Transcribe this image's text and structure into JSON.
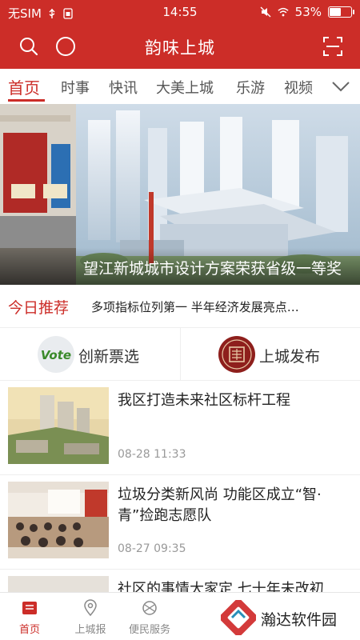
{
  "status_bar": {
    "carrier": "无SIM",
    "time": "14:55",
    "battery_text": "53%",
    "battery_level": 0.53
  },
  "header": {
    "title": "韵味上城",
    "background_color": "#cc2d28",
    "icons": [
      "search-icon",
      "circle-icon",
      "scan-icon"
    ]
  },
  "tabs": [
    {
      "label": "首页",
      "active": true
    },
    {
      "label": "时事",
      "active": false
    },
    {
      "label": "快讯",
      "active": false
    },
    {
      "label": "大美上城",
      "active": false
    },
    {
      "label": "乐游",
      "active": false
    },
    {
      "label": "视频",
      "active": false
    }
  ],
  "hero": {
    "caption": "望江新城城市设计方案荣获省级一等奖"
  },
  "today": {
    "label": "今日推荐",
    "text": "多项指标位列第一 半年经济发展亮点…"
  },
  "shortcuts": [
    {
      "label": "创新票选",
      "logo_text": "Vote"
    },
    {
      "label": "上城发布",
      "logo_text": ""
    }
  ],
  "news": [
    {
      "title": "我区打造未来社区标杆工程",
      "date": "08-28 11:33"
    },
    {
      "title": "垃圾分类新风尚 功能区成立“智·青”捡跑志愿队",
      "date": "08-27 09:35"
    },
    {
      "title": "社区的事情大家定 七十年未改初",
      "date": ""
    }
  ],
  "bottom_nav": [
    {
      "label": "首页",
      "icon": "home-icon",
      "active": true
    },
    {
      "label": "上城报",
      "icon": "location-icon",
      "active": false
    },
    {
      "label": "便民服务",
      "icon": "service-icon",
      "active": false
    }
  ],
  "watermark": {
    "text": "瀚达软件园"
  },
  "colors": {
    "accent": "#cc2d28",
    "text": "#222222",
    "muted": "#999999"
  }
}
